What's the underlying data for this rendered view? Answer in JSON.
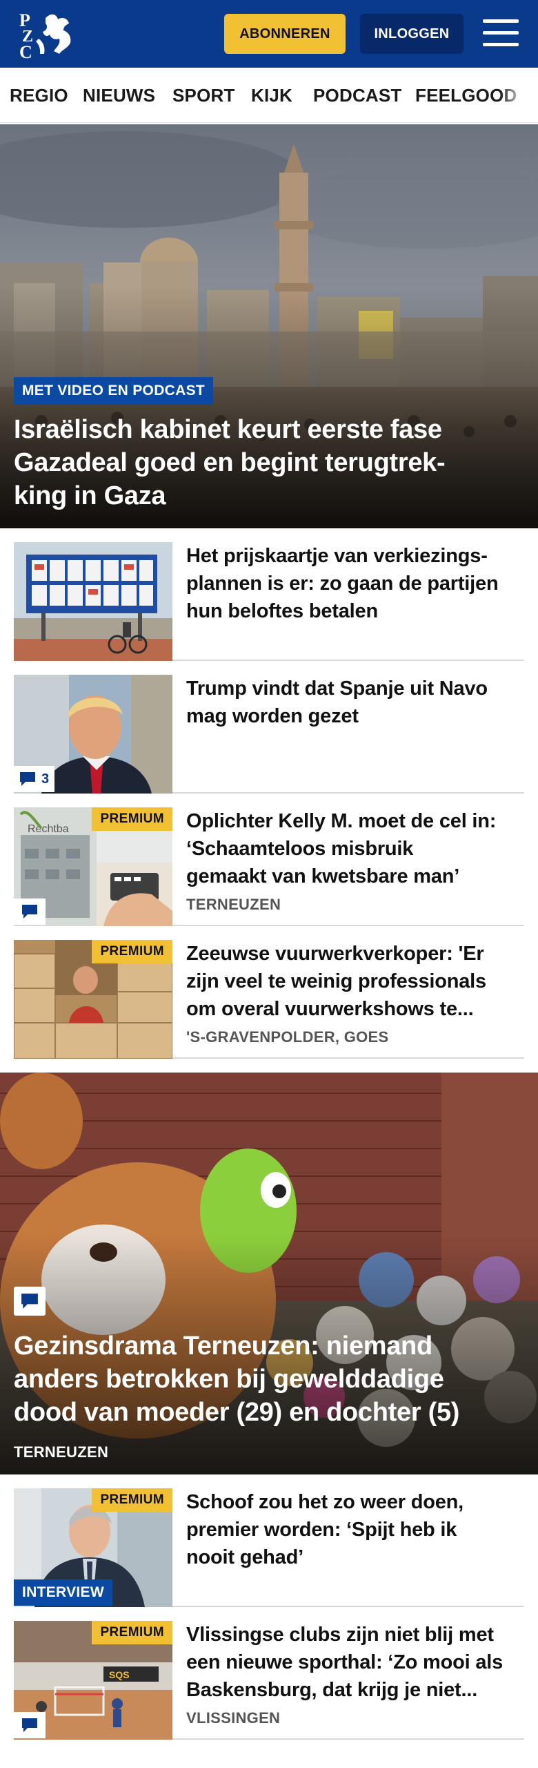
{
  "brand": {
    "logo_text": "PZC",
    "colors": {
      "header": "#0a3a8c",
      "accent": "#f2c033",
      "label": "#0a4aa3"
    }
  },
  "header": {
    "subscribe_label": "ABONNEREN",
    "login_label": "INLOGGEN",
    "menu_icon": "hamburger-menu-icon"
  },
  "nav": {
    "items": [
      "REGIO",
      "NIEUWS",
      "SPORT",
      "KIJK",
      "PODCAST",
      "FEELGOOD"
    ]
  },
  "hero1": {
    "label": "MET VIDEO EN PODCAST",
    "title_lines": [
      "Israëlisch kabinet keurt eerste fase",
      "Gazadeal goed en begint terugtrek-",
      "king in Gaza"
    ]
  },
  "articles": [
    {
      "title_lines": [
        "Het prijskaartje van verkiezings-",
        "plannen is er: zo gaan de partijen",
        "hun beloftes betalen"
      ]
    },
    {
      "title_lines": [
        "Trump vindt dat Spanje uit Navo",
        "mag worden gezet"
      ],
      "comment_count": "3"
    },
    {
      "premium": "PREMIUM",
      "title_lines": [
        "Oplichter Kelly M. moet de cel in:",
        "‘Schaamteloos misbruik",
        "gemaakt van kwetsbare man’"
      ],
      "location": "TERNEUZEN"
    },
    {
      "premium": "PREMIUM",
      "title_lines": [
        "Zeeuwse vuurwerkverkoper: 'Er",
        "zijn veel te weinig professionals",
        "om overal vuurwerkshows te..."
      ],
      "location": "'S-GRAVENPOLDER, GOES"
    }
  ],
  "hero2": {
    "title_lines": [
      "Gezinsdrama Terneuzen: niemand",
      "anders betrokken bij gewelddadige",
      "dood van moeder (29) en dochter (5)"
    ],
    "location": "TERNEUZEN"
  },
  "articles2": [
    {
      "premium": "PREMIUM",
      "label": "INTERVIEW",
      "title_lines": [
        "Schoof zou het zo weer doen,",
        "premier worden: ‘Spijt heb ik",
        "nooit gehad’"
      ]
    },
    {
      "premium": "PREMIUM",
      "title_lines": [
        "Vlissingse clubs zijn niet blij met",
        "een nieuwe sporthal: ‘Zo mooi als",
        "Baskensburg, dat krijg je niet..."
      ],
      "location": "VLISSINGEN"
    }
  ]
}
